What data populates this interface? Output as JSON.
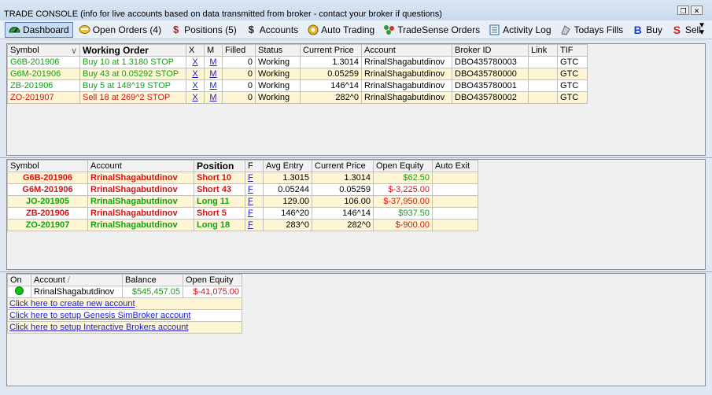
{
  "window": {
    "title": "TRADE CONSOLE  (info for live accounts based on data transmitted from broker - contact your broker if questions)",
    "restore_icon": "restore",
    "close_icon": "x"
  },
  "toolbar": {
    "items": [
      {
        "label": "Dashboard",
        "icon": "dashboard-icon"
      },
      {
        "label": "Open Orders (4)",
        "icon": "orders-icon"
      },
      {
        "label": "Positions (5)",
        "icon": "dollar-icon"
      },
      {
        "label": "Accounts",
        "icon": "dollar-icon"
      },
      {
        "label": "Auto Trading",
        "icon": "auto-icon"
      },
      {
        "label": "TradeSense Orders",
        "icon": "tradesense-icon"
      },
      {
        "label": "Activity Log",
        "icon": "log-icon"
      },
      {
        "label": "Todays Fills",
        "icon": "fills-icon"
      },
      {
        "label": "Buy",
        "icon": "B"
      },
      {
        "label": "Sell",
        "icon": "S"
      }
    ],
    "colors": {
      "buy": "#1f3fbf",
      "sell": "#d42020",
      "positions_dollar": "#c81818"
    }
  },
  "orders": {
    "headers": [
      "Symbol",
      "Working Order",
      "X",
      "M",
      "Filled",
      "Status",
      "Current Price",
      "Account",
      "Broker ID",
      "Link",
      "TIF"
    ],
    "rows": [
      {
        "symbol": "G6B-201906",
        "order": "Buy 10 at 1.3180 STOP",
        "x": "X",
        "m": "M",
        "filled": "0",
        "status": "Working",
        "price": "1.3014",
        "account": "RrinalShagabutdinov",
        "broker_id": "DBO435780003",
        "link": "",
        "tif": "GTC",
        "side": "buy"
      },
      {
        "symbol": "G6M-201906",
        "order": "Buy 43 at 0.05292 STOP",
        "x": "X",
        "m": "M",
        "filled": "0",
        "status": "Working",
        "price": "0.05259",
        "account": "RrinalShagabutdinov",
        "broker_id": "DBO435780000",
        "link": "",
        "tif": "GTC",
        "side": "buy"
      },
      {
        "symbol": "ZB-201906",
        "order": "Buy 5 at 148^19 STOP",
        "x": "X",
        "m": "M",
        "filled": "0",
        "status": "Working",
        "price": "146^14",
        "account": "RrinalShagabutdinov",
        "broker_id": "DBO435780001",
        "link": "",
        "tif": "GTC",
        "side": "buy"
      },
      {
        "symbol": "ZO-201907",
        "order": "Sell 18 at 269^2 STOP",
        "x": "X",
        "m": "M",
        "filled": "0",
        "status": "Working",
        "price": "282^0",
        "account": "RrinalShagabutdinov",
        "broker_id": "DBO435780002",
        "link": "",
        "tif": "GTC",
        "side": "sell"
      }
    ]
  },
  "positions": {
    "headers": [
      "Symbol",
      "Account",
      "Position",
      "F",
      "Avg Entry",
      "Current Price",
      "Open Equity",
      "Auto Exit"
    ],
    "rows": [
      {
        "symbol": "G6B-201906",
        "account": "RrinalShagabutdinov",
        "position": "Short 10",
        "f": "F",
        "avg_entry": "1.3015",
        "price": "1.3014",
        "equity": "$62.50",
        "auto_exit": "",
        "side": "short",
        "equity_sign": "pos"
      },
      {
        "symbol": "G6M-201906",
        "account": "RrinalShagabutdinov",
        "position": "Short 43",
        "f": "F",
        "avg_entry": "0.05244",
        "price": "0.05259",
        "equity": "$-3,225.00",
        "auto_exit": "",
        "side": "short",
        "equity_sign": "neg"
      },
      {
        "symbol": "JO-201905",
        "account": "RrinalShagabutdinov",
        "position": "Long 11",
        "f": "F",
        "avg_entry": "129.00",
        "price": "106.00",
        "equity": "$-37,950.00",
        "auto_exit": "",
        "side": "long",
        "equity_sign": "neg"
      },
      {
        "symbol": "ZB-201906",
        "account": "RrinalShagabutdinov",
        "position": "Short 5",
        "f": "F",
        "avg_entry": "146^20",
        "price": "146^14",
        "equity": "$937.50",
        "auto_exit": "",
        "side": "short",
        "equity_sign": "pos"
      },
      {
        "symbol": "ZO-201907",
        "account": "RrinalShagabutdinov",
        "position": "Long 18",
        "f": "F",
        "avg_entry": "283^0",
        "price": "282^0",
        "equity": "$-900.00",
        "auto_exit": "",
        "side": "long",
        "equity_sign": "neg"
      }
    ]
  },
  "accounts": {
    "headers": [
      "On",
      "Account",
      "Balance",
      "Open Equity"
    ],
    "row": {
      "account": "RrinalShagabutdinov",
      "balance": "$545,457.05",
      "equity": "$-41,075.00"
    },
    "links": [
      "Click here to create new account",
      "Click here to setup Genesis SimBroker account",
      "Click here to setup Interactive Brokers account"
    ]
  }
}
